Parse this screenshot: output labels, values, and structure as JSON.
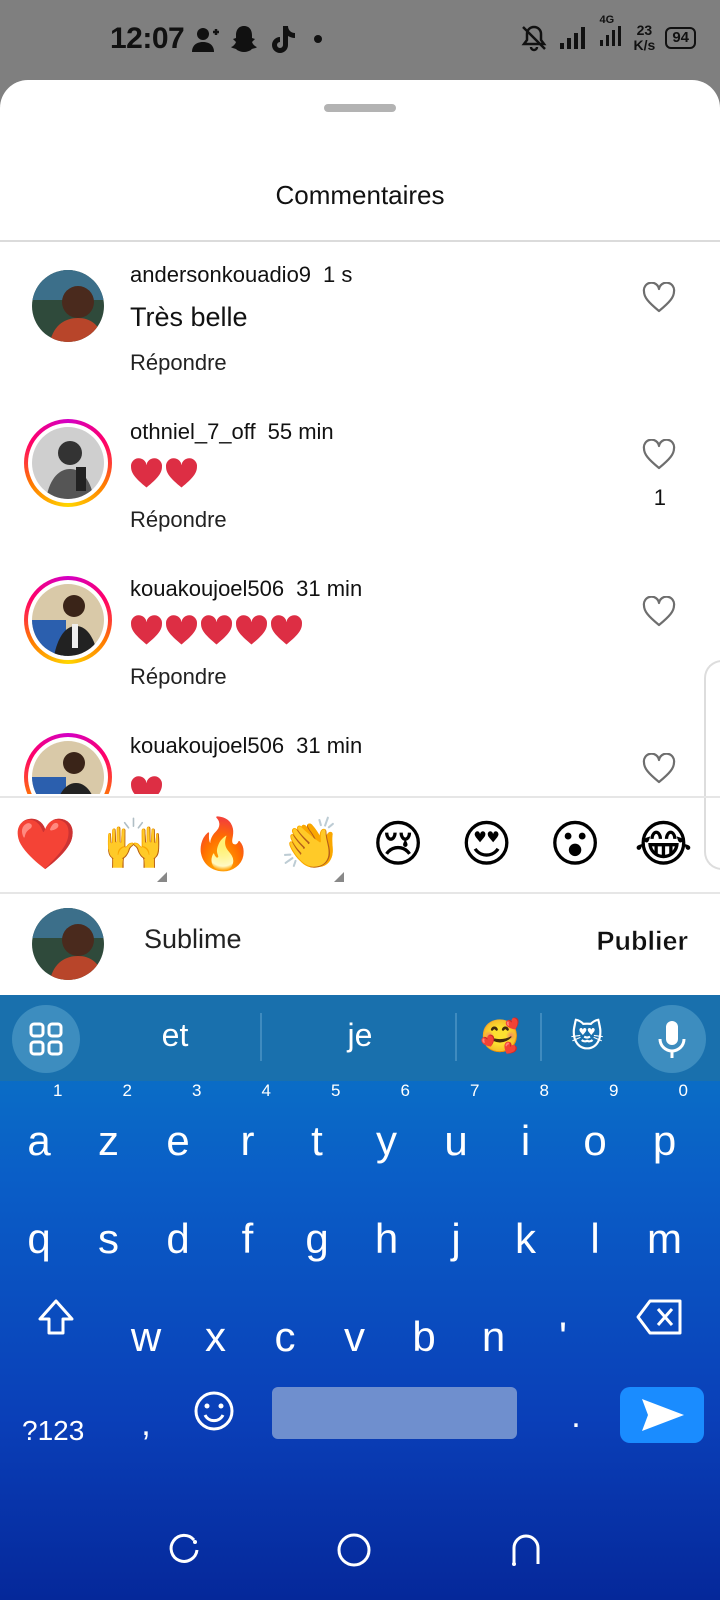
{
  "status_bar": {
    "time": "12:07",
    "network": "4G",
    "speed_value": "23",
    "speed_unit": "K/s",
    "battery": "94",
    "icons": [
      "add-person-icon",
      "snapchat-icon",
      "tiktok-icon",
      "dot-icon",
      "bell-off-icon",
      "signal-icon",
      "signal-4g-icon",
      "battery-icon"
    ]
  },
  "sheet": {
    "title": "Commentaires"
  },
  "comments": [
    {
      "username": "andersonkouadio9",
      "time": "1 s",
      "text": "Très belle",
      "hearts": 0,
      "reply_label": "Répondre",
      "likes": "",
      "ring": false
    },
    {
      "username": "othniel_7_off",
      "time": "55 min",
      "text": "",
      "hearts": 2,
      "reply_label": "Répondre",
      "likes": "1",
      "ring": true
    },
    {
      "username": "kouakoujoel506",
      "time": "31 min",
      "text": "",
      "hearts": 5,
      "reply_label": "Répondre",
      "likes": "",
      "ring": true
    },
    {
      "username": "kouakoujoel506",
      "time": "31 min",
      "text": "",
      "hearts": 0,
      "reply_label": "",
      "likes": "",
      "ring": true
    }
  ],
  "emoji_bar": [
    "❤️",
    "🙌",
    "🔥",
    "👏",
    "😢",
    "😍",
    "😮",
    "😂"
  ],
  "compose": {
    "value": "Sublime",
    "publish_label": "Publier"
  },
  "keyboard": {
    "suggestions": [
      "et",
      "je",
      "🥰",
      "😻"
    ],
    "row1": [
      {
        "k": "a",
        "n": "1"
      },
      {
        "k": "z",
        "n": "2"
      },
      {
        "k": "e",
        "n": "3"
      },
      {
        "k": "r",
        "n": "4"
      },
      {
        "k": "t",
        "n": "5"
      },
      {
        "k": "y",
        "n": "6"
      },
      {
        "k": "u",
        "n": "7"
      },
      {
        "k": "i",
        "n": "8"
      },
      {
        "k": "o",
        "n": "9"
      },
      {
        "k": "p",
        "n": "0"
      }
    ],
    "row2": [
      "q",
      "s",
      "d",
      "f",
      "g",
      "h",
      "j",
      "k",
      "l",
      "m"
    ],
    "row3": [
      "w",
      "x",
      "c",
      "v",
      "b",
      "n",
      "'"
    ],
    "symbols_label": "?123",
    "comma": ",",
    "period": "."
  },
  "colors": {
    "keyboard_top": "#0a7ac4",
    "keyboard_bottom": "#05289a",
    "send_key": "#1a8cff",
    "heart_red": "#dd2e44"
  }
}
